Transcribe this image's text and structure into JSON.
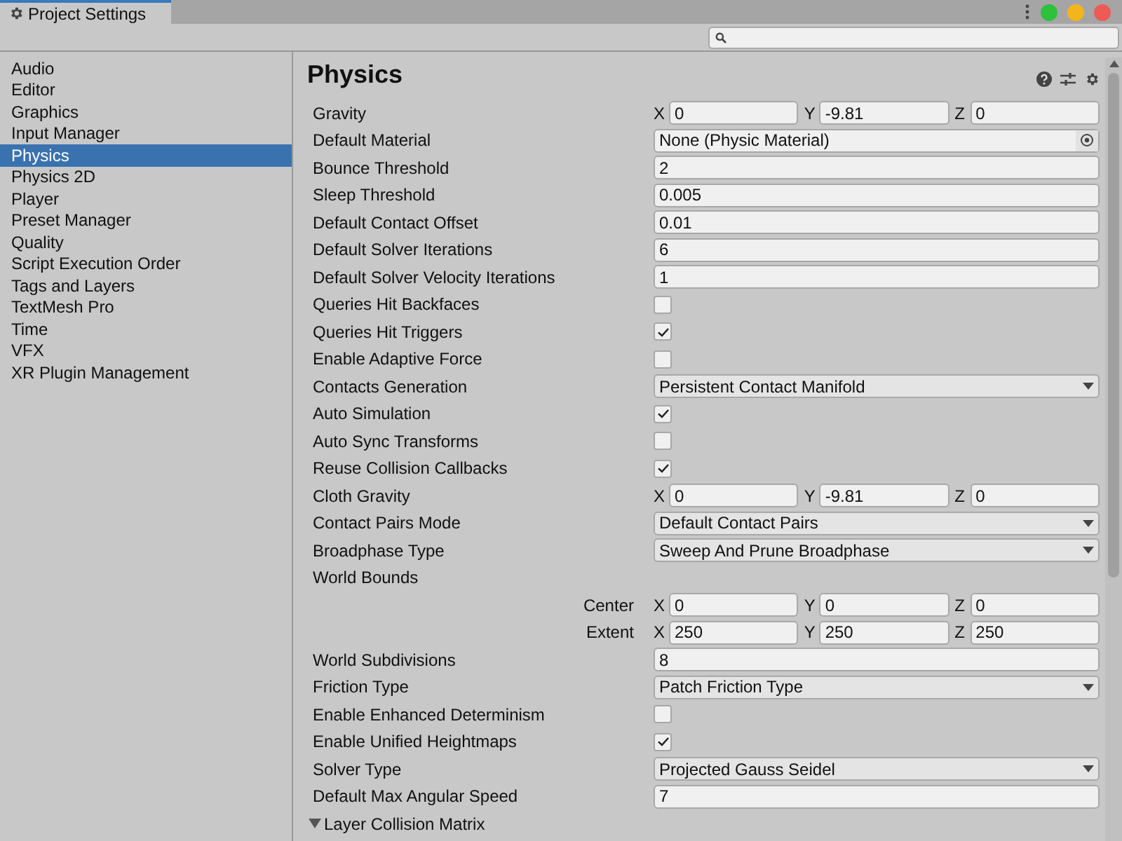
{
  "window": {
    "title": "Project Settings"
  },
  "sidebar": {
    "items": [
      {
        "label": "Audio",
        "selected": false
      },
      {
        "label": "Editor",
        "selected": false
      },
      {
        "label": "Graphics",
        "selected": false
      },
      {
        "label": "Input Manager",
        "selected": false
      },
      {
        "label": "Physics",
        "selected": true
      },
      {
        "label": "Physics 2D",
        "selected": false
      },
      {
        "label": "Player",
        "selected": false
      },
      {
        "label": "Preset Manager",
        "selected": false
      },
      {
        "label": "Quality",
        "selected": false
      },
      {
        "label": "Script Execution Order",
        "selected": false
      },
      {
        "label": "Tags and Layers",
        "selected": false
      },
      {
        "label": "TextMesh Pro",
        "selected": false
      },
      {
        "label": "Time",
        "selected": false
      },
      {
        "label": "VFX",
        "selected": false
      },
      {
        "label": "XR Plugin Management",
        "selected": false
      }
    ]
  },
  "panel": {
    "title": "Physics",
    "rows": [
      {
        "kind": "vector3",
        "label": "Gravity",
        "components": [
          {
            "axis": "X",
            "value": "0"
          },
          {
            "axis": "Y",
            "value": "-9.81"
          },
          {
            "axis": "Z",
            "value": "0"
          }
        ]
      },
      {
        "kind": "object",
        "label": "Default Material",
        "value": "None (Physic Material)"
      },
      {
        "kind": "text",
        "label": "Bounce Threshold",
        "value": "2"
      },
      {
        "kind": "text",
        "label": "Sleep Threshold",
        "value": "0.005"
      },
      {
        "kind": "text",
        "label": "Default Contact Offset",
        "value": "0.01"
      },
      {
        "kind": "text",
        "label": "Default Solver Iterations",
        "value": "6"
      },
      {
        "kind": "text",
        "label": "Default Solver Velocity Iterations",
        "value": "1"
      },
      {
        "kind": "checkbox",
        "label": "Queries Hit Backfaces",
        "checked": false
      },
      {
        "kind": "checkbox",
        "label": "Queries Hit Triggers",
        "checked": true
      },
      {
        "kind": "checkbox",
        "label": "Enable Adaptive Force",
        "checked": false
      },
      {
        "kind": "dropdown",
        "label": "Contacts Generation",
        "value": "Persistent Contact Manifold"
      },
      {
        "kind": "checkbox",
        "label": "Auto Simulation",
        "checked": true
      },
      {
        "kind": "checkbox",
        "label": "Auto Sync Transforms",
        "checked": false
      },
      {
        "kind": "checkbox",
        "label": "Reuse Collision Callbacks",
        "checked": true
      },
      {
        "kind": "vector3",
        "label": "Cloth Gravity",
        "components": [
          {
            "axis": "X",
            "value": "0"
          },
          {
            "axis": "Y",
            "value": "-9.81"
          },
          {
            "axis": "Z",
            "value": "0"
          }
        ]
      },
      {
        "kind": "dropdown",
        "label": "Contact Pairs Mode",
        "value": "Default Contact Pairs"
      },
      {
        "kind": "dropdown",
        "label": "Broadphase Type",
        "value": "Sweep And Prune Broadphase"
      },
      {
        "kind": "header",
        "label": "World Bounds"
      },
      {
        "kind": "subvector3",
        "label": "Center",
        "components": [
          {
            "axis": "X",
            "value": "0"
          },
          {
            "axis": "Y",
            "value": "0"
          },
          {
            "axis": "Z",
            "value": "0"
          }
        ]
      },
      {
        "kind": "subvector3",
        "label": "Extent",
        "components": [
          {
            "axis": "X",
            "value": "250"
          },
          {
            "axis": "Y",
            "value": "250"
          },
          {
            "axis": "Z",
            "value": "250"
          }
        ]
      },
      {
        "kind": "text",
        "label": "World Subdivisions",
        "value": "8"
      },
      {
        "kind": "dropdown",
        "label": "Friction Type",
        "value": "Patch Friction Type"
      },
      {
        "kind": "checkbox",
        "label": "Enable Enhanced Determinism",
        "checked": false
      },
      {
        "kind": "checkbox",
        "label": "Enable Unified Heightmaps",
        "checked": true
      },
      {
        "kind": "dropdown",
        "label": "Solver Type",
        "value": "Projected Gauss Seidel"
      },
      {
        "kind": "text",
        "label": "Default Max Angular Speed",
        "value": "7"
      },
      {
        "kind": "foldout",
        "label": "Layer Collision Matrix",
        "expanded": true
      }
    ]
  }
}
